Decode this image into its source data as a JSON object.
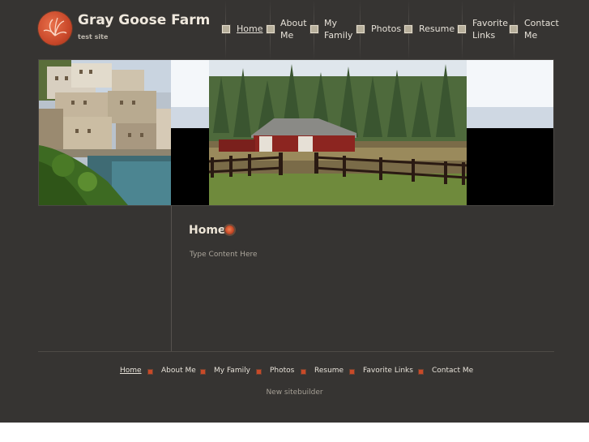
{
  "site": {
    "title": "Gray Goose Farm",
    "subtitle": "test site"
  },
  "nav": {
    "items": [
      {
        "label": "Home",
        "active": true
      },
      {
        "label": "About Me",
        "active": false
      },
      {
        "label": "My Family",
        "active": false
      },
      {
        "label": "Photos",
        "active": false
      },
      {
        "label": "Resume",
        "active": false
      },
      {
        "label": "Favorite Links",
        "active": false
      },
      {
        "label": "Contact Me",
        "active": false
      }
    ]
  },
  "content": {
    "heading": "Home",
    "body": "Type Content Here"
  },
  "footer": {
    "nav": [
      "Home",
      "About Me",
      "My Family",
      "Photos",
      "Resume",
      "Favorite Links",
      "Contact Me"
    ],
    "credit": "New sitebuilder"
  },
  "colors": {
    "background": "#363432",
    "accent": "#c84a28",
    "text": "#e6e1d8"
  },
  "icons": {
    "logo": "orange-circle-logo",
    "heading": "orange-dot-icon",
    "nav_bullet": "square-bullet-icon"
  }
}
